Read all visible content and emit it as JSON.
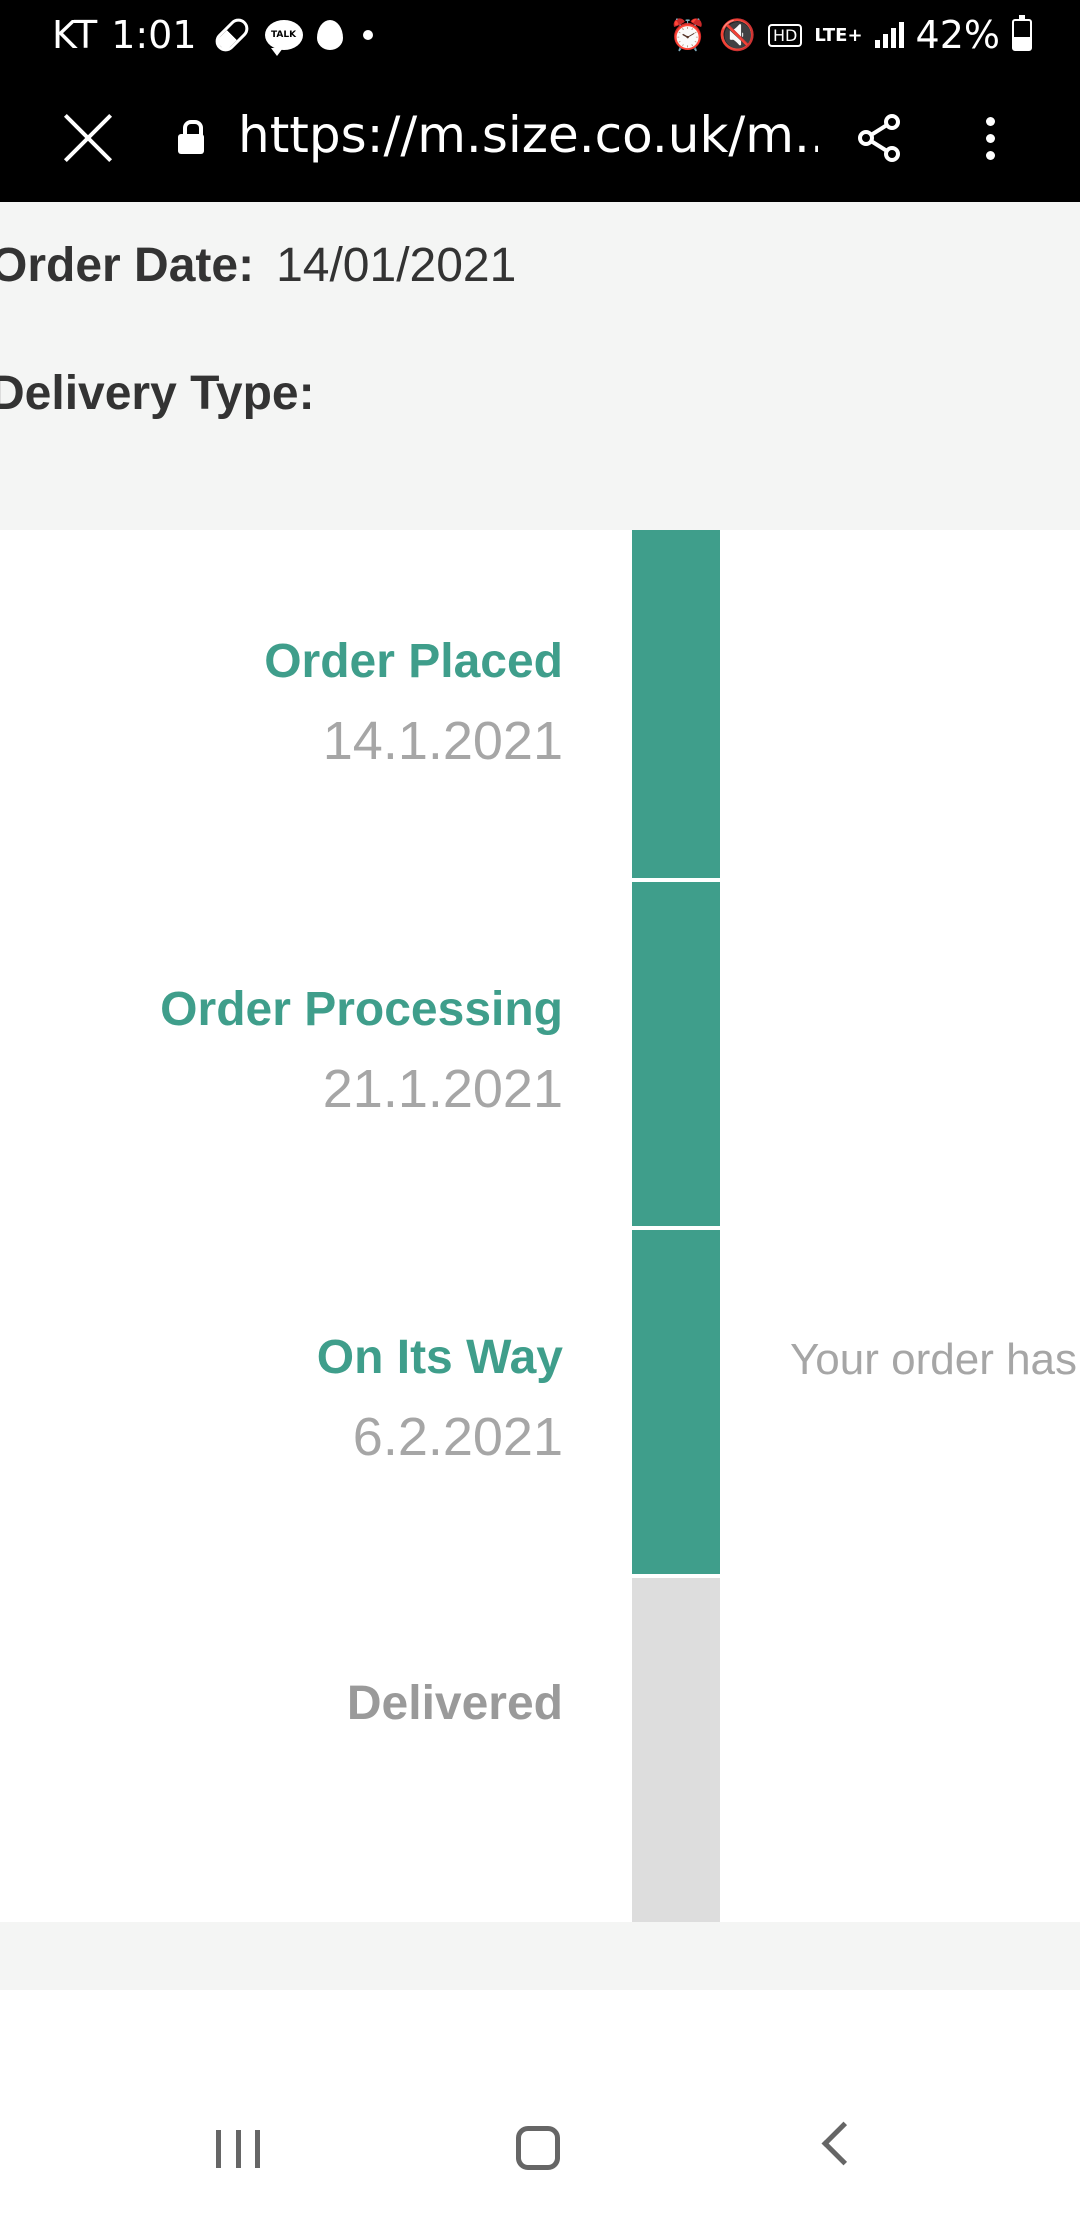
{
  "status_bar": {
    "carrier": "KT",
    "time": "1:01",
    "talk_badge": "TALK",
    "hd_badge": "HD",
    "network": "LTE+",
    "battery_percent": "42%",
    "battery_level": 0.42
  },
  "browser": {
    "url": "https://m.size.co.uk/m..."
  },
  "order_details": {
    "order_date_label": "Order Date:",
    "order_date_value": "14/01/2021",
    "delivery_type_label": "Delivery Type:",
    "delivery_type_value": ""
  },
  "timeline": {
    "accent_color": "#3f9e8b",
    "steps": [
      {
        "title": "Order Placed",
        "date": "14.1.2021",
        "status": "done",
        "message": ""
      },
      {
        "title": "Order Processing",
        "date": "21.1.2021",
        "status": "done",
        "message": ""
      },
      {
        "title": "On Its Way",
        "date": "6.2.2021",
        "status": "done",
        "message": "Your order has despatched"
      },
      {
        "title": "Delivered",
        "date": "",
        "status": "pending",
        "message": ""
      }
    ]
  }
}
